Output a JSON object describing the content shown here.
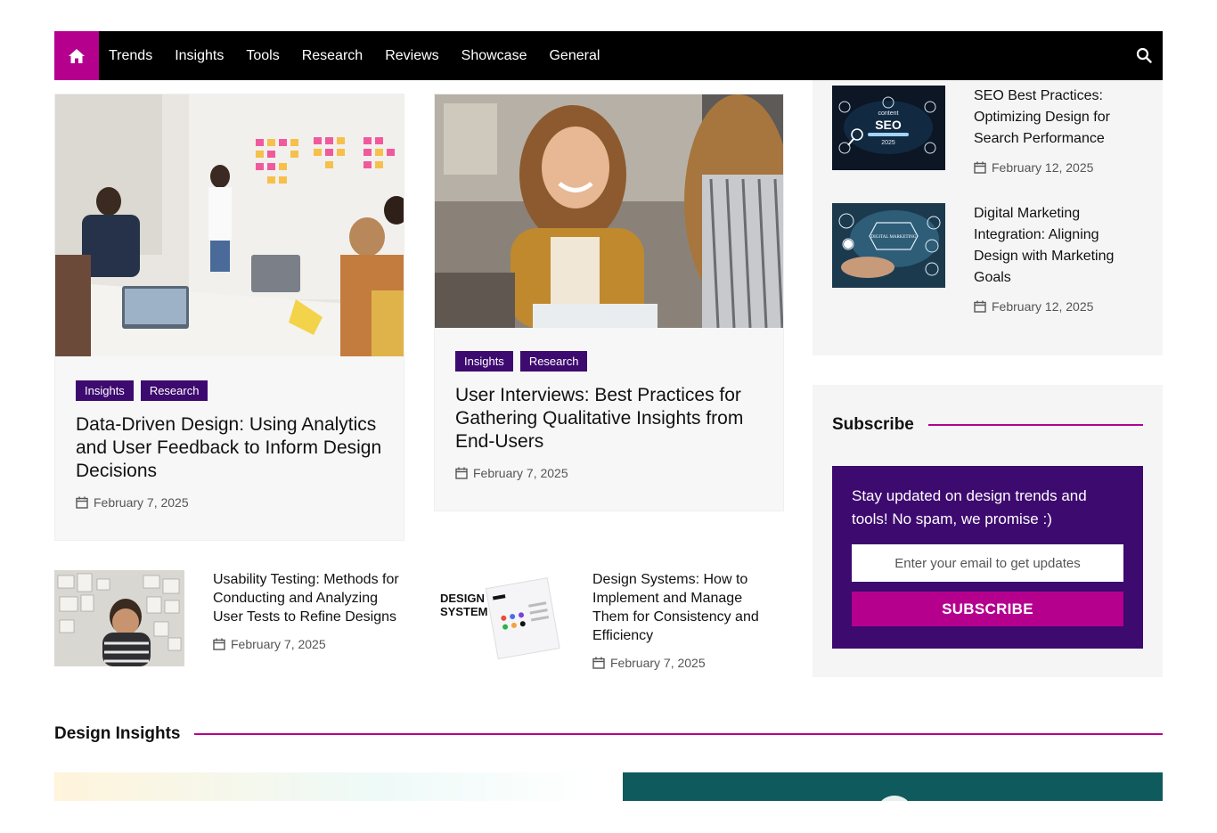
{
  "nav": {
    "home_icon": "home-icon",
    "items": [
      "Trends",
      "Insights",
      "Tools",
      "Research",
      "Reviews",
      "Showcase",
      "General"
    ],
    "search_icon": "search-icon"
  },
  "featured": [
    {
      "badges": [
        "Insights",
        "Research"
      ],
      "title": "Data-Driven Design: Using Analytics and User Feedback to Inform Design Decisions",
      "date": "February 7, 2025"
    },
    {
      "badges": [
        "Insights",
        "Research"
      ],
      "title": "User Interviews: Best Practices for Gathering Qualitative Insights from End-Users",
      "date": "February 7, 2025"
    }
  ],
  "small_posts": [
    {
      "title": "Usability Testing: Methods for Conducting and Analyzing User Tests to Refine Designs",
      "date": "February 7, 2025"
    },
    {
      "title": "Design Systems: How to Implement and Manage Them for Consistency and Efficiency",
      "date": "February 7, 2025",
      "thumb_text": [
        "DESIGN",
        "SYSTEM"
      ]
    }
  ],
  "sidebar_posts": [
    {
      "title": "SEO Best Practices: Optimizing Design for Search Performance",
      "date": "February 12, 2025",
      "thumb_text": [
        "SEO",
        "2025",
        "content"
      ]
    },
    {
      "title": "Digital Marketing Integration: Aligning Design with Marketing Goals",
      "date": "February 12, 2025",
      "thumb_text": "DIGITAL MARKETING"
    }
  ],
  "subscribe": {
    "heading": "Subscribe",
    "text": "Stay updated on design trends and tools! No spam, we promise :)",
    "placeholder": "Enter your email to get updates",
    "button": "SUBSCRIBE"
  },
  "design_insights": {
    "heading": "Design Insights"
  },
  "colors": {
    "accent": "#b5008e",
    "badge": "#3d0a6f",
    "nav_bg": "#000000"
  }
}
